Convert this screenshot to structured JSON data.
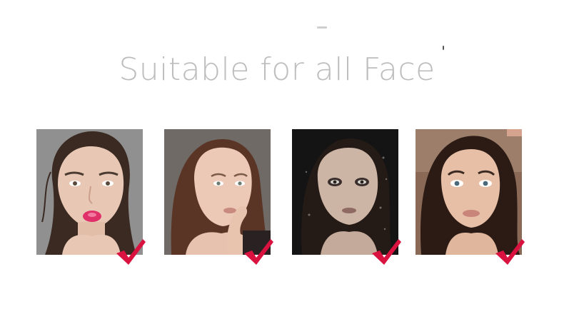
{
  "headline": "Suitable for all Face",
  "colors": {
    "headline": "#bdbdbd",
    "checkmark": "#d9123f",
    "background": "#ffffff"
  },
  "photos": [
    {
      "subject": "face-photo-1",
      "backdrop": "#8f8f8f",
      "hair": "#3a2a22",
      "skin": "#e8c7b4",
      "lips": "#e0306a",
      "check_icon": "check-mark-icon"
    },
    {
      "subject": "face-photo-2",
      "backdrop": "#6f6a66",
      "hair": "#5a3526",
      "skin": "#ecc9b6",
      "lips": "#c98a80",
      "check_icon": "check-mark-icon"
    },
    {
      "subject": "face-photo-3",
      "backdrop": "#141414",
      "hair": "#241a16",
      "skin": "#cdb5a6",
      "lips": "#8e6a62",
      "check_icon": "check-mark-icon"
    },
    {
      "subject": "face-photo-4",
      "backdrop": "#7a5c49",
      "hair": "#2c1b14",
      "skin": "#e6bfa6",
      "lips": "#c9857a",
      "check_icon": "check-mark-icon"
    }
  ]
}
